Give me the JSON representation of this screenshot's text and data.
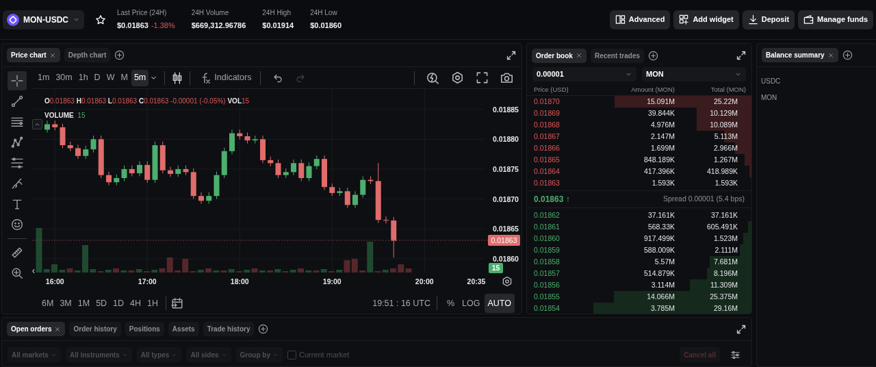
{
  "market": {
    "symbol": "MON-USDC",
    "favorite": false
  },
  "stats": [
    {
      "label": "Last Price (24H)",
      "value": "$0.01863",
      "change": "-1.38%"
    },
    {
      "label": "24H Volume",
      "value": "$669,312.96786"
    },
    {
      "label": "24H High",
      "value": "$0.01914"
    },
    {
      "label": "24H Low",
      "value": "$0.01860"
    }
  ],
  "header_buttons": [
    {
      "label": "Advanced",
      "kind": "advanced"
    },
    {
      "label": "Add widget",
      "kind": "widget"
    },
    {
      "label": "Deposit",
      "kind": "deposit"
    },
    {
      "label": "Manage funds",
      "kind": "wallet"
    }
  ],
  "chart_panel": {
    "tabs": [
      {
        "label": "Price chart",
        "selected": true
      },
      {
        "label": "Depth chart",
        "selected": false
      }
    ],
    "tools": [
      {
        "kind": "crosshair",
        "selected": true
      },
      {
        "kind": "trendline",
        "selected": false
      },
      {
        "kind": "hlines",
        "selected": false
      },
      {
        "kind": "pattern",
        "selected": false
      },
      {
        "kind": "fib",
        "selected": false
      },
      {
        "kind": "brush",
        "selected": false
      },
      {
        "kind": "text",
        "selected": false
      },
      {
        "kind": "smiley",
        "selected": false
      },
      {
        "kind": "ruler",
        "selected": false
      },
      {
        "kind": "zoomin",
        "selected": false
      }
    ],
    "intervals": [
      {
        "label": "1m",
        "selected": false
      },
      {
        "label": "30m",
        "selected": false
      },
      {
        "label": "1h",
        "selected": false
      },
      {
        "label": "D",
        "selected": false
      },
      {
        "label": "W",
        "selected": false
      },
      {
        "label": "M",
        "selected": false
      },
      {
        "label": "5m",
        "selected": true
      }
    ],
    "indicators_label": "Indicators",
    "history": [
      {
        "kind": "undo",
        "disabled": false
      },
      {
        "kind": "redo",
        "disabled": true
      }
    ],
    "ohlc_legend": [
      {
        "label": "O",
        "value": "0.01863"
      },
      {
        "label": "H",
        "value": "0.01863"
      },
      {
        "label": "L",
        "value": "0.01863"
      },
      {
        "label": "C",
        "value": "0.01863 -0.00001 (-0.05%)"
      },
      {
        "label": "VOL",
        "value": "15"
      }
    ],
    "volume_legend": {
      "label": "VOLUME",
      "value": "15"
    },
    "chart_data": {
      "type": "candlestick",
      "grid": true,
      "categories": [
        null,
        "16:00",
        null,
        null,
        null,
        null,
        null,
        null,
        null,
        null,
        null,
        null,
        null,
        "17:00",
        null,
        null,
        null,
        null,
        null,
        null,
        null,
        null,
        null,
        null,
        null,
        "18:00",
        null,
        null,
        null,
        null,
        null,
        null,
        null,
        null,
        null,
        null,
        null,
        "19:00",
        null,
        null,
        null,
        null,
        null,
        null,
        null,
        null,
        null,
        null,
        null,
        "20:00",
        null,
        null,
        null,
        null,
        null,
        null,
        "20:35"
      ],
      "ylim": [
        0.018577,
        0.018884
      ],
      "ohlc": [
        [
          0.018816,
          0.018831,
          0.018811,
          0.018825
        ],
        [
          0.018825,
          0.018831,
          0.018815,
          0.01882
        ],
        [
          0.01882,
          0.018826,
          0.018785,
          0.01879
        ],
        [
          0.01879,
          0.018796,
          0.01878,
          0.018785
        ],
        [
          0.018785,
          0.018791,
          0.018767,
          0.018772
        ],
        [
          0.018772,
          0.018789,
          0.018767,
          0.018783
        ],
        [
          0.018783,
          0.018806,
          0.018778,
          0.0188
        ],
        [
          0.0188,
          0.018806,
          0.018735,
          0.01874
        ],
        [
          0.01874,
          0.018746,
          0.018723,
          0.018728
        ],
        [
          0.018728,
          0.018741,
          0.018723,
          0.018735
        ],
        [
          0.018735,
          0.018756,
          0.01873,
          0.01875
        ],
        [
          0.01875,
          0.018756,
          0.018738,
          0.018743
        ],
        [
          0.018743,
          0.018763,
          0.018738,
          0.018757
        ],
        [
          0.018757,
          0.018763,
          0.018727,
          0.018732
        ],
        [
          0.018732,
          0.018796,
          0.018727,
          0.01879
        ],
        [
          0.01879,
          0.018796,
          0.018743,
          0.018748
        ],
        [
          0.018748,
          0.018754,
          0.018737,
          0.018742
        ],
        [
          0.018742,
          0.018756,
          0.018737,
          0.01875
        ],
        [
          0.01875,
          0.018756,
          0.01874,
          0.018745
        ],
        [
          0.018745,
          0.018751,
          0.0187,
          0.018705
        ],
        [
          0.018705,
          0.018711,
          0.018692,
          0.018697
        ],
        [
          0.018697,
          0.018711,
          0.018692,
          0.018705
        ],
        [
          0.018705,
          0.018746,
          0.0187,
          0.01874
        ],
        [
          0.01874,
          0.018786,
          0.018735,
          0.01878
        ],
        [
          0.01878,
          0.018816,
          0.018775,
          0.01881
        ],
        [
          0.01881,
          0.018816,
          0.0188,
          0.018805
        ],
        [
          0.018805,
          0.018811,
          0.018793,
          0.018798
        ],
        [
          0.018798,
          0.018806,
          0.018793,
          0.0188
        ],
        [
          0.0188,
          0.018806,
          0.01876,
          0.018765
        ],
        [
          0.018765,
          0.018771,
          0.018755,
          0.01876
        ],
        [
          0.01876,
          0.018766,
          0.018735,
          0.01874
        ],
        [
          0.01874,
          0.018751,
          0.018735,
          0.018745
        ],
        [
          0.018745,
          0.018766,
          0.01874,
          0.01876
        ],
        [
          0.01876,
          0.018766,
          0.01873,
          0.018735
        ],
        [
          0.018735,
          0.018761,
          0.01873,
          0.018755
        ],
        [
          0.018755,
          0.018773,
          0.01875,
          0.018767
        ],
        [
          0.018767,
          0.018773,
          0.018715,
          0.01872
        ],
        [
          0.01872,
          0.018726,
          0.018705,
          0.01871
        ],
        [
          0.01871,
          0.018719,
          0.018705,
          0.018713
        ],
        [
          0.018713,
          0.018719,
          0.018685,
          0.01869
        ],
        [
          0.01869,
          0.018713,
          0.018685,
          0.018707
        ],
        [
          0.018707,
          0.018738,
          0.018702,
          0.018732
        ],
        [
          0.018732,
          0.018738,
          0.018725,
          0.01873
        ],
        [
          0.01873,
          0.01876,
          0.01866,
          0.018665
        ],
        [
          0.018665,
          0.018671,
          0.018659,
          0.018664
        ],
        [
          0.018664,
          0.01867,
          0.018602,
          0.01863
        ],
        null,
        null,
        null,
        null,
        null,
        null,
        null,
        null,
        null,
        null,
        null
      ],
      "yticks": [
        {
          "value": 0.01885,
          "label": "0.01885"
        },
        {
          "value": 0.0188,
          "label": "0.01880"
        },
        {
          "value": 0.01875,
          "label": "0.01875"
        },
        {
          "value": 0.0187,
          "label": "0.01870"
        },
        {
          "value": 0.01865,
          "label": "0.01865"
        },
        {
          "value": 0.0186,
          "label": "0.01860"
        }
      ]
    },
    "current_price": "0.01863",
    "current_volume": "15",
    "ranges": [
      "6M",
      "3M",
      "1M",
      "5D",
      "1D",
      "4H",
      "1H"
    ],
    "clock": "19:51 : 16 UTC",
    "scale_options": [
      {
        "label": "%",
        "selected": false
      },
      {
        "label": "LOG",
        "selected": false
      },
      {
        "label": "AUTO",
        "selected": true
      }
    ]
  },
  "order_book": {
    "tabs": [
      {
        "label": "Order book",
        "selected": true
      },
      {
        "label": "Recent trades",
        "selected": false
      }
    ],
    "tick_size": "0.00001",
    "unit": "MON",
    "columns": [
      "Price (USD)",
      "Amount (MON)",
      "Total (MON)"
    ],
    "asks": [
      {
        "price": "0.01870",
        "amount": "15.091M",
        "total": "25.22M"
      },
      {
        "price": "0.01869",
        "amount": "39.844K",
        "total": "10.129M"
      },
      {
        "price": "0.01868",
        "amount": "4.976M",
        "total": "10.089M"
      },
      {
        "price": "0.01867",
        "amount": "2.147M",
        "total": "5.113M"
      },
      {
        "price": "0.01866",
        "amount": "1.699M",
        "total": "2.966M"
      },
      {
        "price": "0.01865",
        "amount": "848.189K",
        "total": "1.267M"
      },
      {
        "price": "0.01864",
        "amount": "417.396K",
        "total": "418.989K"
      },
      {
        "price": "0.01863",
        "amount": "1.593K",
        "total": "1.593K"
      }
    ],
    "last_price": "0.01863",
    "arrow": "↑",
    "spread": "Spread 0.00001 (5.4 bps)",
    "bids": [
      {
        "price": "0.01862",
        "amount": "37.161K",
        "total": "37.161K"
      },
      {
        "price": "0.01861",
        "amount": "568.33K",
        "total": "605.491K"
      },
      {
        "price": "0.01860",
        "amount": "917.499K",
        "total": "1.523M"
      },
      {
        "price": "0.01859",
        "amount": "588.009K",
        "total": "2.111M"
      },
      {
        "price": "0.01858",
        "amount": "5.57M",
        "total": "7.681M"
      },
      {
        "price": "0.01857",
        "amount": "514.879K",
        "total": "8.196M"
      },
      {
        "price": "0.01856",
        "amount": "3.114M",
        "total": "11.309M"
      },
      {
        "price": "0.01855",
        "amount": "14.066M",
        "total": "25.375M"
      },
      {
        "price": "0.01854",
        "amount": "3.785M",
        "total": "29.16M"
      }
    ]
  },
  "balance_panel": {
    "tabs": [
      {
        "label": "Balance summary",
        "selected": true
      }
    ],
    "assets": [
      "USDC",
      "MON"
    ]
  },
  "orders_panel": {
    "tabs": [
      {
        "label": "Open orders",
        "selected": true
      },
      {
        "label": "Order history",
        "selected": false
      },
      {
        "label": "Positions",
        "selected": false
      },
      {
        "label": "Assets",
        "selected": false
      },
      {
        "label": "Trade history",
        "selected": false
      }
    ],
    "filters": [
      "All markets",
      "All instruments",
      "All types",
      "All sides",
      "Group by"
    ],
    "current_market": {
      "label": "Current market",
      "checked": false
    },
    "cancel_all": {
      "label": "Cancel all",
      "disabled": true
    }
  }
}
